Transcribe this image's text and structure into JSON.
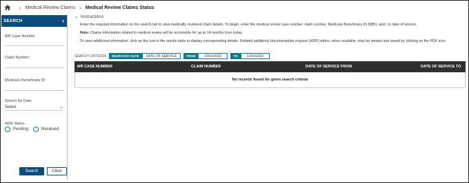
{
  "breadcrumb": {
    "home_icon": "home-icon",
    "items": [
      "Medical Review Claims",
      "Medical Review Claims Status"
    ]
  },
  "sidebar": {
    "title": "SEARCH",
    "fields": {
      "mr_case_number": "MR Case Number",
      "claim_number": "Claim Number",
      "mbi": "Medicare Beneficiary ID",
      "search_by_date_label": "Search By Date",
      "search_by_date_value": "Select",
      "adr_status_label": "ADR Status",
      "pending": "Pending",
      "received": "Received"
    },
    "search_button": "Search",
    "clear_button": "Clear"
  },
  "instructions": {
    "toggle_label": "Instructions",
    "line1": "Enter the required information on the search tab to view medically reviewed claim details. To begin, enter the medical review case number, claim number, Medicare Beneficiary ID (MBI), and / or date of service.",
    "line2_bold": "Note:",
    "line2": " Claims information related to medical review will be accessible for up to 14 months from today.",
    "line3": "To view additional information, click on the row in the results table to display corresponding details. Related additional documentation request (ADR) letters, when available, may be viewed and saved by clicking on the PDF icon."
  },
  "criteria": {
    "label": "SEARCH CRITERIA:",
    "search_by_date": "SEARCH BY DATE",
    "date_type": "DATE OF SERVICE",
    "from_label": "FROM",
    "from_value": "10/10/2022",
    "to_label": "TO",
    "to_value": "11/02/2022"
  },
  "table": {
    "headers": [
      "MR CASE NUMBER",
      "CLAIM NUMBER",
      "DATE OF SERVICE FROM",
      "DATE OF SERVICE TO"
    ],
    "empty_message": "No records found for given search criteria"
  },
  "colors": {
    "primary": "#0b4c7b",
    "teal": "#0f7a8c",
    "table_header": "#2f2f2f"
  }
}
